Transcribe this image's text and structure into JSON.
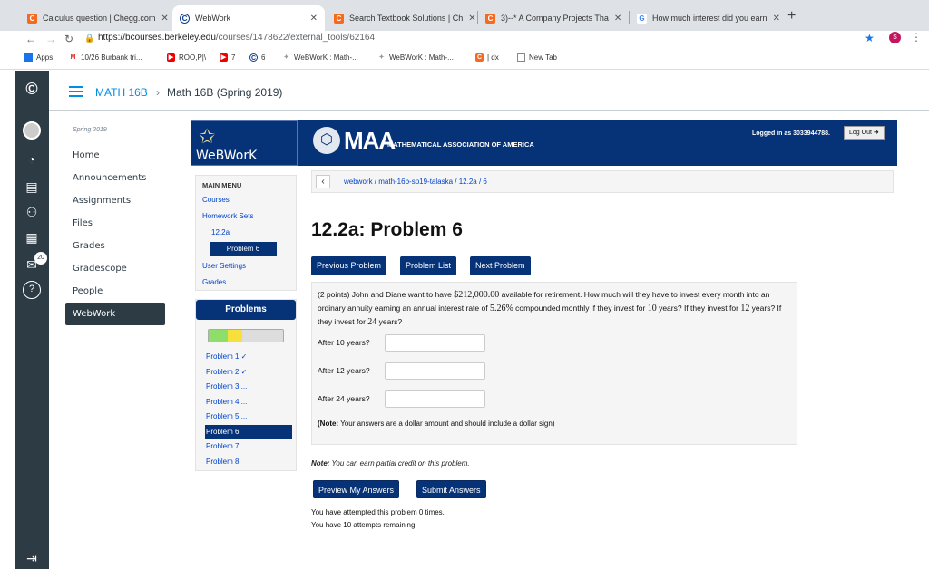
{
  "browser": {
    "tabs": [
      {
        "label": "Calculus question | Chegg.com",
        "icon": "chegg-icon",
        "color": "#f56a1f"
      },
      {
        "label": "WebWork",
        "icon": "canvas-icon",
        "color": "#0b3d91"
      },
      {
        "label": "Search Textbook Solutions | Ch",
        "icon": "chegg-icon",
        "color": "#f56a1f"
      },
      {
        "label": "3)--* A Company Projects Tha",
        "icon": "chegg-icon",
        "color": "#f56a1f"
      },
      {
        "label": "How much interest did you earn",
        "icon": "google-icon",
        "color": "#4285f4"
      }
    ],
    "url_domain": "https://bcourses.berkeley.edu",
    "url_path": "/courses/1478622/external_tools/62164",
    "profile_initial": "S",
    "bookmarks": [
      {
        "label": "Apps",
        "icon": "apps-icon"
      },
      {
        "label": "10/26 Burbank tri...",
        "icon": "gmail-icon"
      },
      {
        "label": "ROO,P|\\",
        "icon": "youtube-icon"
      },
      {
        "label": "7",
        "icon": "youtube-icon"
      },
      {
        "label": "6",
        "icon": "canvas-icon"
      },
      {
        "label": "WeBWorK : Math-...",
        "icon": "webwork-icon"
      },
      {
        "label": "WeBWorK : Math-...",
        "icon": "webwork-icon"
      },
      {
        "label": "| dx",
        "icon": "chegg-icon"
      },
      {
        "label": "New Tab",
        "icon": "page-icon"
      }
    ]
  },
  "canvas": {
    "badge_count": "20",
    "breadcrumb": {
      "course": "MATH 16B",
      "separator": "›",
      "current": "Math 16B (Spring 2019)"
    },
    "term": "Spring 2019",
    "course_nav": [
      "Home",
      "Announcements",
      "Assignments",
      "Files",
      "Grades",
      "Gradescope",
      "People",
      "WebWork"
    ],
    "active_nav": "WebWork"
  },
  "webwork": {
    "logo_text": "WeBWorK",
    "maa_big": "MAA",
    "maa_small": "MATHEMATICAL ASSOCIATION OF AMERICA",
    "logged_in": "Logged in as 3033944788.",
    "logout": "Log Out",
    "main_menu": {
      "heading": "MAIN MENU",
      "courses": "Courses",
      "homework_sets": "Homework Sets",
      "set": "12.2a",
      "problem": "Problem 6",
      "user_settings": "User Settings",
      "grades": "Grades"
    },
    "problems_heading": "Problems",
    "progress": {
      "correct_fraction": 0.25,
      "partial_fraction": 0.2,
      "colors": {
        "correct": "#8ede6a",
        "partial": "#f7e03b"
      }
    },
    "problem_list": [
      "Problem 1 ✓",
      "Problem 2 ✓",
      "Problem 3 ...",
      "Problem 4 ...",
      "Problem 5 ...",
      "Problem 6",
      "Problem 7",
      "Problem 8"
    ],
    "path": "webwork / math-16b-sp19-talaska / 12.2a / 6",
    "title": "12.2a: Problem 6",
    "nav_buttons": [
      "Previous Problem",
      "Problem List",
      "Next Problem"
    ],
    "problem": {
      "intro": "(2 points) John and Diane want to have ",
      "amount": "$212,000.00",
      "mid": " available for retirement. How much will they have to invest every month into an ordinary annuity earning an annual interest rate of ",
      "rate": "5.26%",
      "mid2": " compounded monthly if they invest for ",
      "years1": "10",
      "mid3": " years? If they invest for ",
      "years2": "12",
      "mid4": " years? If they invest for ",
      "years3": "24",
      "end": " years?",
      "q1": "After 10 years?",
      "q2": "After 12 years?",
      "q3": "After 24 years?",
      "note_bold": "(Note:",
      "note_rest": " Your answers are a dollar amount and should include a dollar sign)"
    },
    "partial_note_bold": "Note:",
    "partial_note": " You can earn partial credit on this problem.",
    "preview_label": "Preview My Answers",
    "submit_label": "Submit Answers",
    "attempted": "You have attempted this problem 0 times.",
    "remaining": "You have 10 attempts remaining."
  }
}
